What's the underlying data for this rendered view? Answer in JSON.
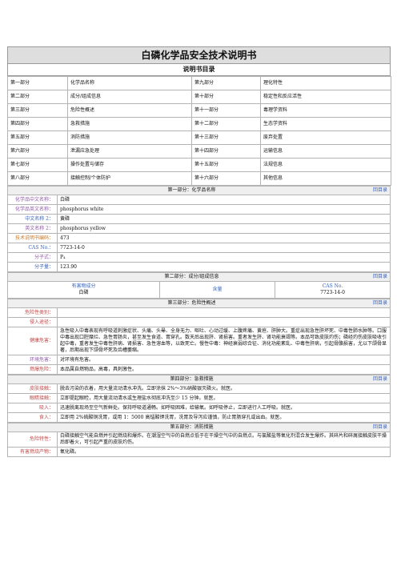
{
  "title": "白磷化学品安全技术说明书",
  "subtitle": "说明书目录",
  "toc": [
    {
      "part": "第一部分",
      "name": "化学品名称",
      "part2": "第九部分",
      "name2": "理化特性"
    },
    {
      "part": "第二部分",
      "name": "成分/组成信息",
      "part2": "第十部分",
      "name2": "稳定性和反应活性"
    },
    {
      "part": "第三部分",
      "name": "危险性概述",
      "part2": "第十一部分",
      "name2": "毒理学资料"
    },
    {
      "part": "第四部分",
      "name": "急救措施",
      "part2": "第十二部分",
      "name2": "生态学资料"
    },
    {
      "part": "第五部分",
      "name": "消防措施",
      "part2": "第十三部分",
      "name2": "废弃处置"
    },
    {
      "part": "第六部分",
      "name": "泄漏应急处理",
      "part2": "第十四部分",
      "name2": "运输信息"
    },
    {
      "part": "第七部分",
      "name": "操作处置与储存",
      "part2": "第十五部分",
      "name2": "法规信息"
    },
    {
      "part": "第八部分",
      "name": "接触控制/个体防护",
      "part2": "第十六部分",
      "name2": "其他信息"
    }
  ],
  "back": "回目录",
  "s1": {
    "heading": "第一部分：化学品名称",
    "rows": [
      {
        "label": "化学品中文名称：",
        "value": "白磷"
      },
      {
        "label": "化学品英文名称：",
        "value": "phosphorus white"
      },
      {
        "label": "中文名称 2：",
        "value": "黄磷"
      },
      {
        "label": "英文名称 2：",
        "value": "phosphorus yellow"
      },
      {
        "label": "技术说明书编码：",
        "value": "473"
      },
      {
        "label": "CAS No.：",
        "value": "7723-14-0"
      },
      {
        "label": "分子式：",
        "value": "P₄"
      },
      {
        "label": "分子量：",
        "value": "123.90"
      }
    ]
  },
  "s2": {
    "heading": "第二部分：成分/组成信息",
    "col1": "有害物成分",
    "col2": "含量",
    "col3": "CAS No.",
    "v1": "白磷",
    "v2": "",
    "v3": "7723-14-0"
  },
  "s3": {
    "heading": "第三部分：危险性概述",
    "rows": [
      {
        "label": "危险性类别：",
        "value": ""
      },
      {
        "label": "侵入途径：",
        "value": ""
      },
      {
        "label": "健康危害：",
        "value": "急性吸入中毒表现有呼吸道刺激症状、头痛、头晕、全身无力、呕吐、心动过缓、上腹疼痛、黄疸、肝肿大。重症出现急性肝坏死、中毒性肺水肿等。口服中毒出现口腔糜烂、急性胃肠炎，甚至发生食道、胃穿孔。数天后出现肝、肾损害。重者发生肝、肾功能衰竭等。本品可致皮肤灼伤；磷经灼伤皮肤吸收引起中毒，重者发生中毒性肝病、肾损害、急性溶血等，以致死亡。慢性中毒：神经衰弱综合征、消化功能紊乱、中毒性肝病，引起骨骼损害，尤以下颌骨显著，后期出现下颌骨坏死及齿槽萎缩。"
      },
      {
        "label": "环境危害：",
        "value": "对环境有危害。"
      },
      {
        "label": "燃爆危险：",
        "value": "本品属自燃物品，高毒，具刺激性。"
      }
    ]
  },
  "s4": {
    "heading": "第四部分：急救措施",
    "rows": [
      {
        "label": "皮肤接触：",
        "value": "脱去污染的衣着，用大量流动清水冲洗。立即涂抹 2%～3%硝酸银灭磷火。就医。"
      },
      {
        "label": "眼睛接触：",
        "value": "立即提起眼睑，用大量流动清水或生理盐水彻底冲洗至少 15 分钟。就医。"
      },
      {
        "label": "吸入：",
        "value": "迅速脱离现场至空气新鲜处。保持呼吸道通畅。如呼吸困难，给输氧。如呼吸停止，立即进行人工呼吸。就医。"
      },
      {
        "label": "食入：",
        "value": "立即用 2%硫酸铜洗胃，或用 1：5000 高锰酸钾洗胃，洗胃及导泻应谨慎，防止胃肠穿孔或出血。就医。"
      }
    ]
  },
  "s5": {
    "heading": "第五部分：消防措施",
    "rows": [
      {
        "label": "危险特性：",
        "value": "白磷接触空气能自燃并引起燃烧和爆炸。在潮湿空气中的自燃点低于在干燥空气中的自燃点。与氯酸盐等氧化剂混合发生爆炸。其碎片和碎屑接触皮肤干燥后即着火，可引起严重的皮肤灼伤。"
      },
      {
        "label": "有害燃烧产物：",
        "value": "氧化磷。"
      }
    ]
  }
}
